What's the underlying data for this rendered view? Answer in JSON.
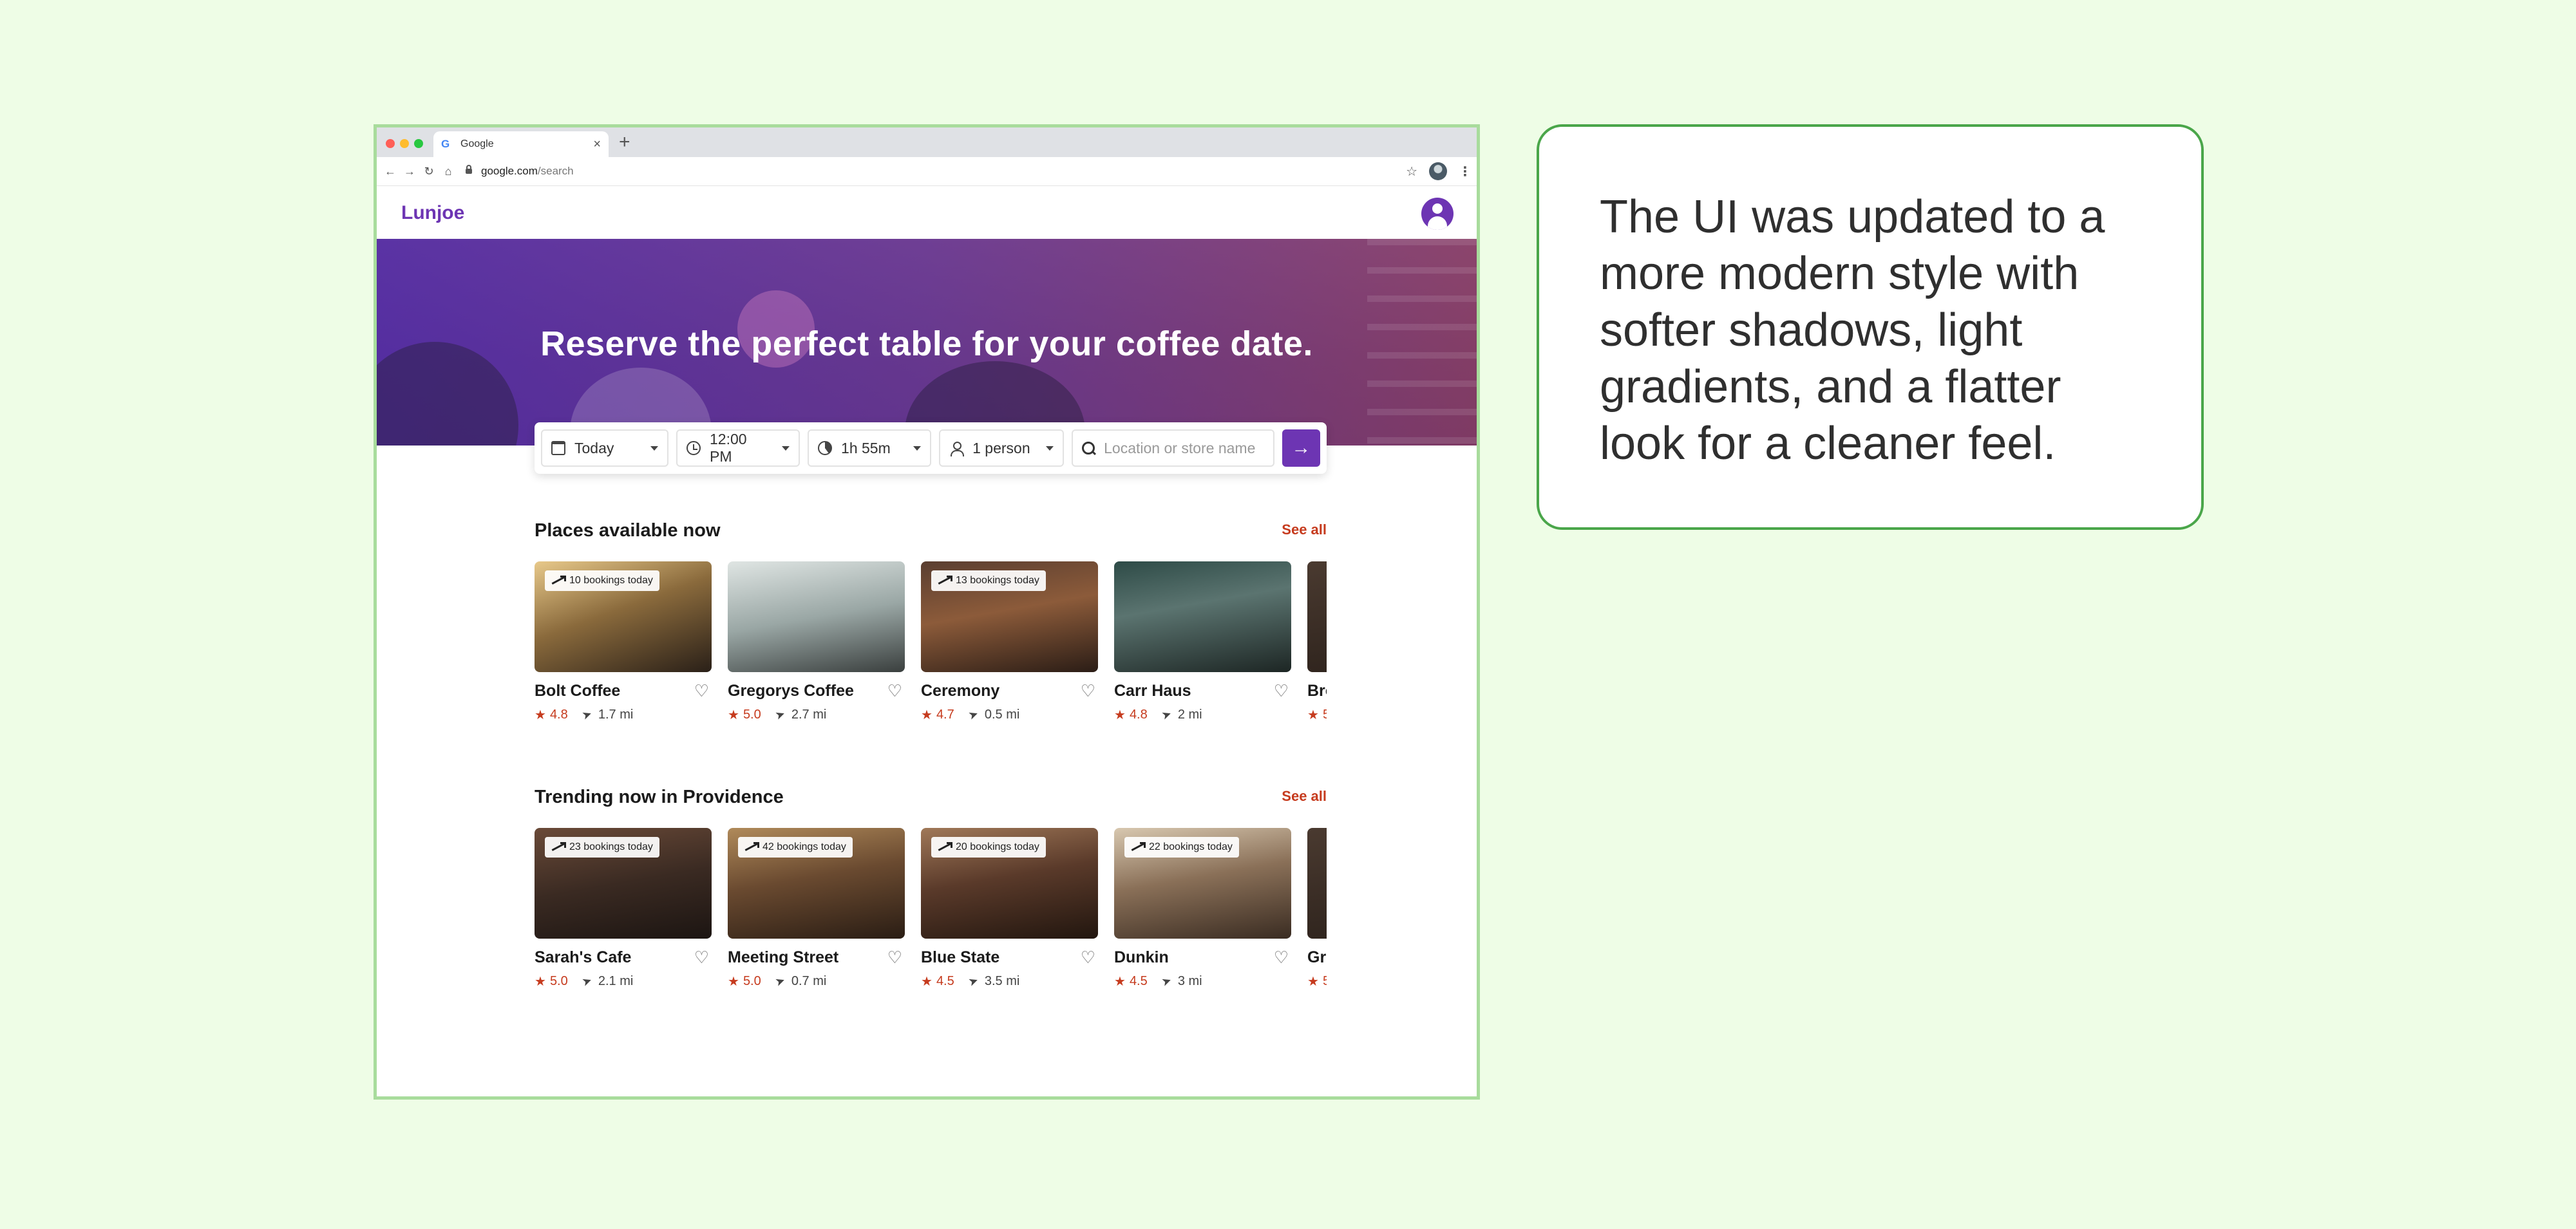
{
  "browser": {
    "tab_title": "Google",
    "url_host": "google.com",
    "url_path": "/search"
  },
  "app": {
    "brand": "Lunjoe",
    "hero_title": "Reserve the perfect table for your coffee date."
  },
  "search": {
    "date": "Today",
    "time": "12:00 PM",
    "duration": "1h 55m",
    "party": "1 person",
    "location_placeholder": "Location or store name",
    "go_icon": "arrow-right-icon"
  },
  "sections": [
    {
      "title": "Places available now",
      "see_all": "See all",
      "cards": [
        {
          "name": "Bolt Coffee",
          "badge": "10 bookings today",
          "rating": "4.8",
          "distance": "1.7 mi"
        },
        {
          "name": "Gregorys Coffee",
          "badge": "",
          "rating": "5.0",
          "distance": "2.7 mi"
        },
        {
          "name": "Ceremony",
          "badge": "13 bookings today",
          "rating": "4.7",
          "distance": "0.5 mi"
        },
        {
          "name": "Carr Haus",
          "badge": "",
          "rating": "4.8",
          "distance": "2 mi"
        },
        {
          "name": "Bro",
          "badge": "",
          "rating": "5",
          "distance": ""
        }
      ]
    },
    {
      "title": "Trending now in Providence",
      "see_all": "See all",
      "cards": [
        {
          "name": "Sarah's Cafe",
          "badge": "23 bookings today",
          "rating": "5.0",
          "distance": "2.1 mi"
        },
        {
          "name": "Meeting Street",
          "badge": "42 bookings today",
          "rating": "5.0",
          "distance": "0.7 mi"
        },
        {
          "name": "Blue State",
          "badge": "20 bookings today",
          "rating": "4.5",
          "distance": "3.5 mi"
        },
        {
          "name": "Dunkin",
          "badge": "22 bookings today",
          "rating": "4.5",
          "distance": "3 mi"
        },
        {
          "name": "Gr",
          "badge": "",
          "rating": "5",
          "distance": ""
        }
      ]
    }
  ],
  "caption": "The UI was updated to a more modern style with softer shadows, light gradients, and a flatter look for a cleaner feel.",
  "colors": {
    "brand": "#6d35b3",
    "accent": "#c63b1e",
    "background": "#eefde6",
    "caption_border": "#4aa64a"
  }
}
